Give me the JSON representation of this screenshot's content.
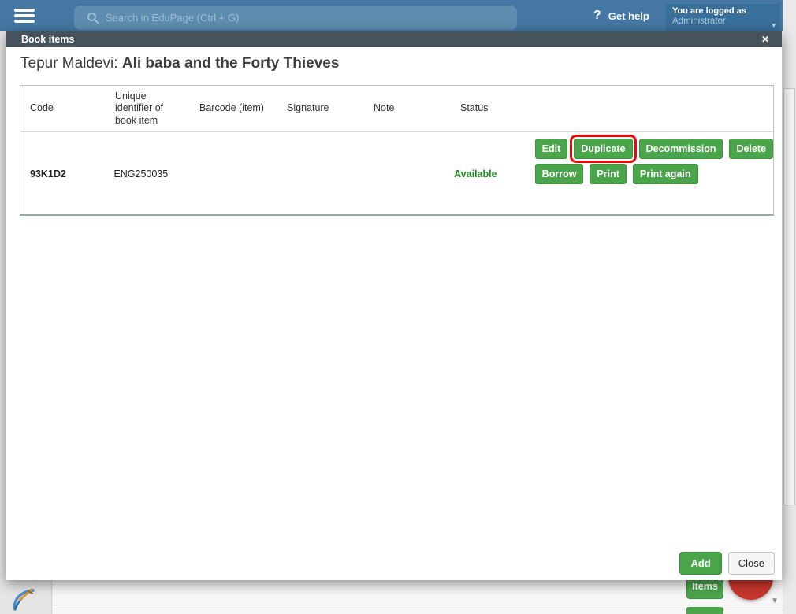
{
  "topbar": {
    "search_placeholder": "Search in EduPage (Ctrl + G)",
    "help_icon": "?",
    "help_label": "Get help",
    "account": {
      "line1": "You are logged as",
      "line2": "Administrator"
    }
  },
  "modal": {
    "window_title": "Book items",
    "heading_prefix": "Tepur Maldevi: ",
    "heading_book": "Ali baba and the Forty Thieves",
    "table": {
      "columns": [
        "Code",
        "Unique identifier of book item",
        "Barcode (item)",
        "Signature",
        "Note",
        "Status"
      ],
      "rows": [
        {
          "code": "93K1D2",
          "unique_identifier": "ENG250035",
          "barcode": "",
          "signature": "",
          "note": "",
          "status": "Available",
          "actions_row1": [
            "Edit",
            "Duplicate",
            "Decommission",
            "Delete"
          ],
          "actions_row2": [
            "Borrow",
            "Print",
            "Print again"
          ]
        }
      ]
    },
    "footer": {
      "add_label": "Add",
      "close_label": "Close"
    }
  },
  "annotation": {
    "highlighted_button": "Duplicate"
  },
  "page_background": {
    "items_button_label": "Items"
  },
  "icons": {
    "close": "✕",
    "chevron_down": "▾",
    "scroll_down": "▼",
    "hamburger": "menu",
    "search": "magnifier",
    "logo": "edupage-pen"
  },
  "colors": {
    "topbar_blue": "#4478a3",
    "searchbox_blue": "#5e8db0",
    "account_blue": "#39709b",
    "modal_header_slate": "#46535d",
    "button_green": "#4ba54b",
    "status_green": "#1f8c1f",
    "highlight_red": "#e60c0c",
    "fab_red": "#c8372d"
  }
}
